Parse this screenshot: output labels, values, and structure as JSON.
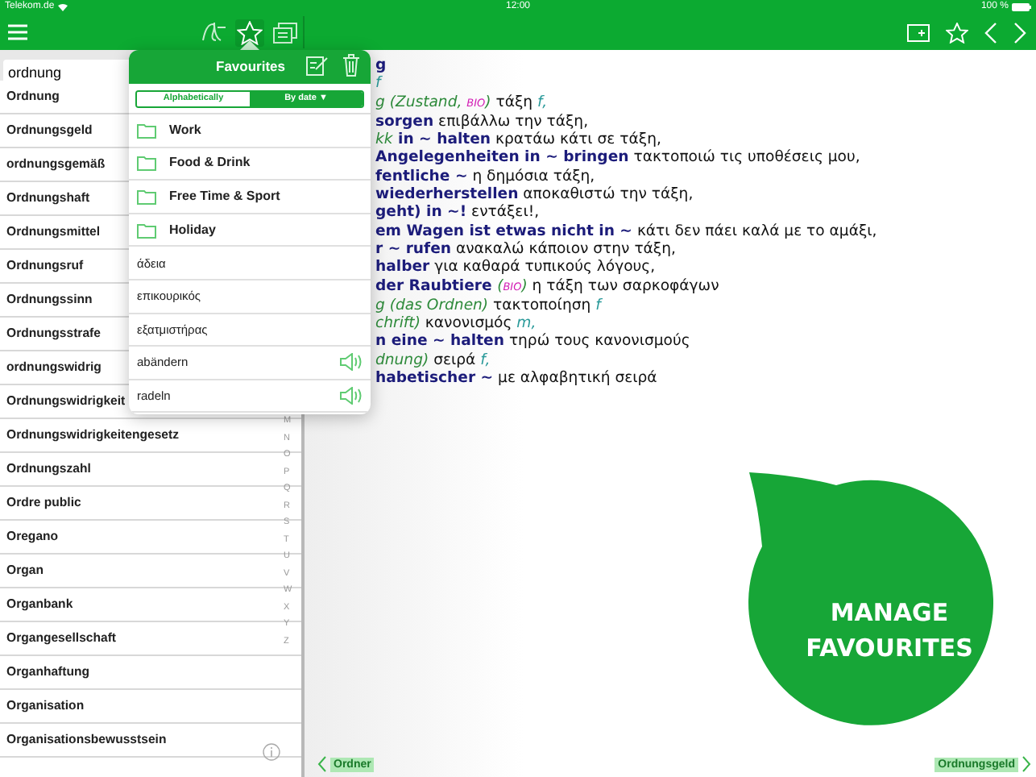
{
  "status_bar": {
    "carrier": "Telekom.de",
    "time": "12:00",
    "battery": "100 %"
  },
  "toolbar_tabs": [
    {
      "kind": "handwriting",
      "selected": false
    },
    {
      "kind": "favourites",
      "selected": true
    },
    {
      "kind": "flashcards",
      "selected": false
    }
  ],
  "search": {
    "value": "ordnung"
  },
  "word_list": [
    "Ordnung",
    "Ordnungsgeld",
    "ordnungsgemäß",
    "Ordnungshaft",
    "Ordnungsmittel",
    "Ordnungsruf",
    "Ordnungssinn",
    "Ordnungsstrafe",
    "ordnungswidrig",
    "Ordnungswidrigkeit",
    "Ordnungswidrigkeitengesetz",
    "Ordnungszahl",
    "Ordre public",
    "Oregano",
    "Organ",
    "Organbank",
    "Organgesellschaft",
    "Organhaftung",
    "Organisation",
    "Organisationsbewusstsein"
  ],
  "alphabet_index": [
    "M",
    "N",
    "O",
    "P",
    "Q",
    "R",
    "S",
    "T",
    "U",
    "V",
    "W",
    "X",
    "Y",
    "Z"
  ],
  "favourites": {
    "title": "Favourites",
    "sort_options": [
      {
        "label": "Alphabetically",
        "selected": false
      },
      {
        "label": "By date ▼",
        "selected": true
      }
    ],
    "items": [
      {
        "kind": "folder",
        "label": "Work",
        "audio": false
      },
      {
        "kind": "folder",
        "label": "Food & Drink",
        "audio": false
      },
      {
        "kind": "folder",
        "label": "Free Time & Sport",
        "audio": false
      },
      {
        "kind": "folder",
        "label": "Holiday",
        "audio": false
      },
      {
        "kind": "word",
        "label": "άδεια",
        "audio": false
      },
      {
        "kind": "word",
        "label": "επικουρικός",
        "audio": false
      },
      {
        "kind": "word",
        "label": "εξατμιστήρας",
        "audio": false
      },
      {
        "kind": "word",
        "label": "abändern",
        "audio": true
      },
      {
        "kind": "word",
        "label": "radeln",
        "audio": true
      }
    ]
  },
  "entry": {
    "lines": [
      [
        {
          "kind": "head",
          "text": "g"
        }
      ],
      [
        {
          "kind": "gender",
          "text": "f"
        }
      ],
      [
        {
          "kind": "gram",
          "text": "g (Zustand, "
        },
        {
          "kind": "label",
          "text": "ΒΙΟ"
        },
        {
          "kind": "gram",
          "text": ")"
        },
        {
          "kind": "trans",
          "text": " τάξη "
        },
        {
          "kind": "gender",
          "text": "f,"
        }
      ],
      [
        {
          "kind": "head",
          "text": "sorgen"
        },
        {
          "kind": "trans",
          "text": " επιβάλλω την τάξη,"
        }
      ],
      [
        {
          "kind": "gram",
          "text": "kk"
        },
        {
          "kind": "head",
          "text": " in ~ halten"
        },
        {
          "kind": "trans",
          "text": " κρατάω κάτι σε τάξη,"
        }
      ],
      [
        {
          "kind": "head",
          "text": "Angelegenheiten in ~ bringen"
        },
        {
          "kind": "trans",
          "text": " τακτοποιώ τις υποθέσεις μου,"
        }
      ],
      [
        {
          "kind": "head",
          "text": "fentliche ~"
        },
        {
          "kind": "trans",
          "text": " η δημόσια τάξη,"
        }
      ],
      [
        {
          "kind": "head",
          "text": "wiederherstellen"
        },
        {
          "kind": "trans",
          "text": " αποκαθιστώ την τάξη,"
        }
      ],
      [
        {
          "kind": "head",
          "text": "geht) in ~!"
        },
        {
          "kind": "trans",
          "text": " εντάξει!,"
        }
      ],
      [
        {
          "kind": "head",
          "text": "em Wagen ist etwas nicht in ~"
        },
        {
          "kind": "trans",
          "text": " κάτι δεν πάει καλά με το αμάξι,"
        }
      ],
      [
        {
          "kind": "head",
          "text": "r ~ rufen"
        },
        {
          "kind": "trans",
          "text": " ανακαλώ κάποιον στην τάξη,"
        }
      ],
      [
        {
          "kind": "head",
          "text": "halber"
        },
        {
          "kind": "trans",
          "text": " για καθαρά τυπικούς λόγους,"
        }
      ],
      [
        {
          "kind": "head",
          "text": "der Raubtiere "
        },
        {
          "kind": "gram",
          "text": "("
        },
        {
          "kind": "label",
          "text": "ΒΙΟ"
        },
        {
          "kind": "gram",
          "text": ")"
        },
        {
          "kind": "trans",
          "text": " η τάξη των σαρκοφάγων"
        }
      ],
      [
        {
          "kind": "gram",
          "text": "g (das Ordnen)"
        },
        {
          "kind": "trans",
          "text": " τακτοποίηση "
        },
        {
          "kind": "gender",
          "text": "f"
        }
      ],
      [
        {
          "kind": "gram",
          "text": "chrift)"
        },
        {
          "kind": "trans",
          "text": " κανονισμός "
        },
        {
          "kind": "gender",
          "text": "m,"
        }
      ],
      [
        {
          "kind": "head",
          "text": "n eine ~ halten"
        },
        {
          "kind": "trans",
          "text": " τηρώ τους κανονισμούς"
        }
      ],
      [
        {
          "kind": "gram",
          "text": "dnung)"
        },
        {
          "kind": "trans",
          "text": " σειρά "
        },
        {
          "kind": "gender",
          "text": "f,"
        }
      ],
      [
        {
          "kind": "head",
          "text": "habetischer ~"
        },
        {
          "kind": "trans",
          "text": " με αλφαβητική σειρά"
        }
      ]
    ]
  },
  "nav": {
    "previous": "Ordner",
    "next": "Ordnungsgeld"
  },
  "callout": "MANAGE FAVOURITES"
}
